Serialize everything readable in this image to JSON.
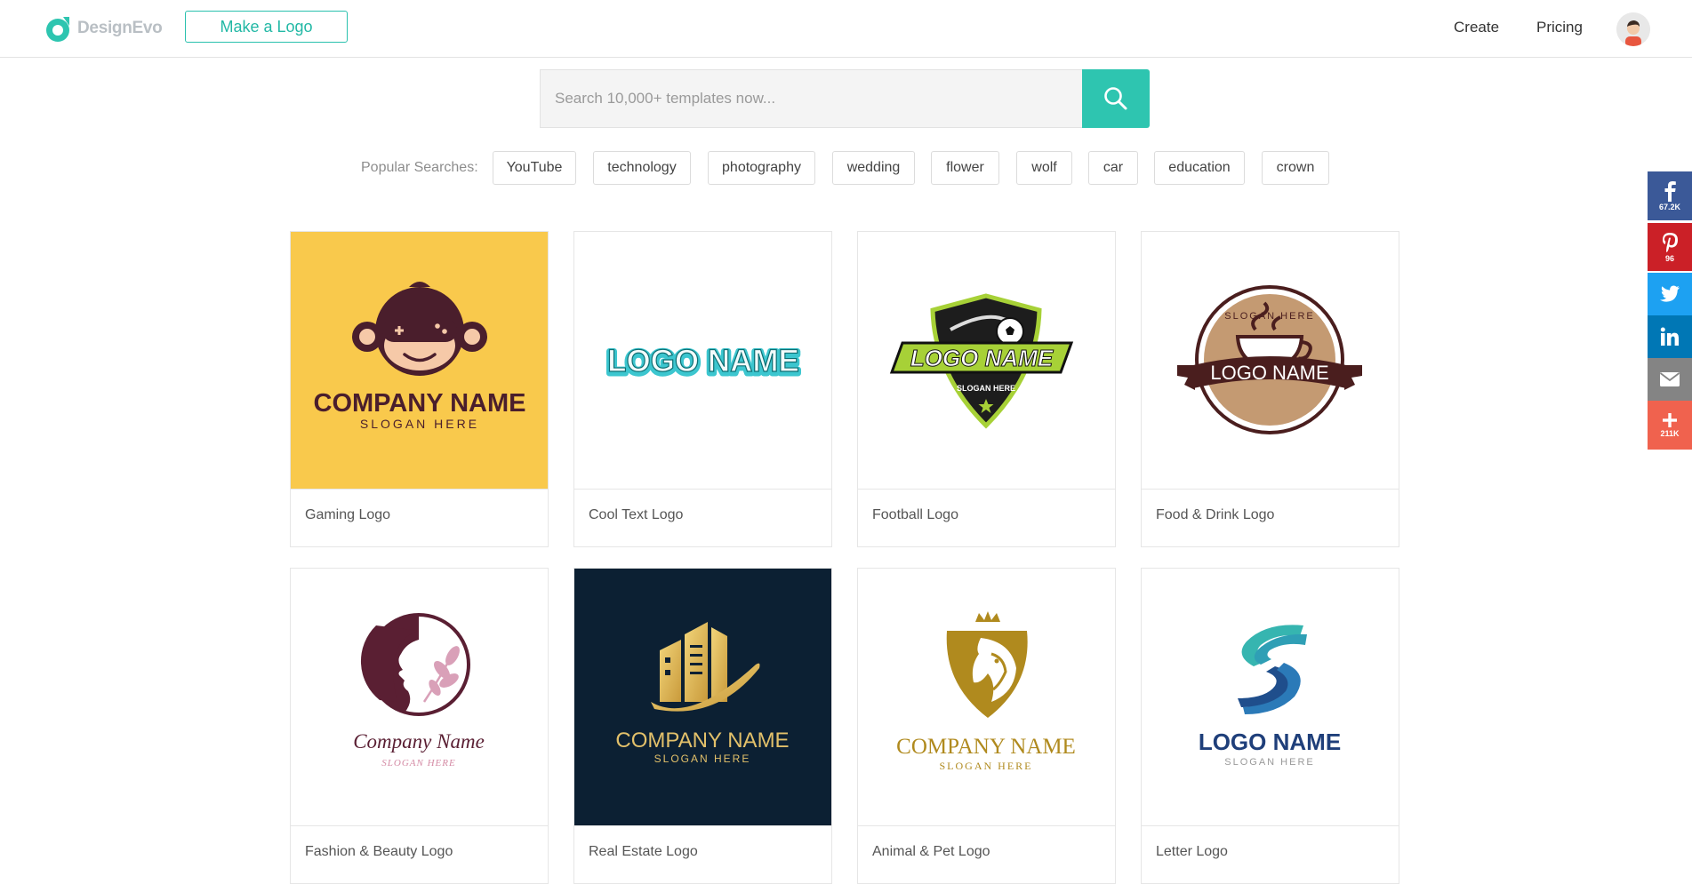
{
  "header": {
    "logo_text": "DesignEvo",
    "make_logo_label": "Make a Logo",
    "nav": {
      "create": "Create",
      "pricing": "Pricing"
    }
  },
  "search": {
    "placeholder": "Search 10,000+ templates now...",
    "value": "",
    "icon": "search-icon"
  },
  "popular": {
    "label": "Popular Searches:",
    "tags": [
      "YouTube",
      "technology",
      "photography",
      "wedding",
      "flower",
      "wolf",
      "car",
      "education",
      "crown"
    ]
  },
  "cards": [
    {
      "label": "Gaming Logo",
      "title": "COMPANY NAME",
      "slogan": "SLOGAN HERE"
    },
    {
      "label": "Cool Text Logo",
      "title": "LOGO NAME"
    },
    {
      "label": "Football Logo",
      "title": "LOGO NAME",
      "slogan": "SLOGAN HERE"
    },
    {
      "label": "Food & Drink Logo",
      "title": "LOGO NAME",
      "slogan": "SLOGAN HERE"
    },
    {
      "label": "Fashion & Beauty Logo",
      "title": "Company Name",
      "slogan": "SLOGAN HERE"
    },
    {
      "label": "Real Estate Logo",
      "title": "COMPANY NAME",
      "slogan": "SLOGAN HERE"
    },
    {
      "label": "Animal & Pet Logo",
      "title": "COMPANY NAME",
      "slogan": "SLOGAN HERE"
    },
    {
      "label": "Letter Logo",
      "title": "LOGO NAME",
      "slogan": "SLOGAN HERE"
    }
  ],
  "social": {
    "facebook": {
      "count": "67.2K",
      "color": "#3b5998"
    },
    "pinterest": {
      "count": "96",
      "color": "#cb2027"
    },
    "twitter": {
      "color": "#1da1f2"
    },
    "linkedin": {
      "color": "#0077b5"
    },
    "email": {
      "color": "#848484"
    },
    "more": {
      "count": "211K",
      "color": "#f0624e"
    }
  },
  "colors": {
    "accent": "#2ec5b0",
    "gaming_bg": "#f9c94c",
    "realestate_bg": "#0c2033"
  }
}
